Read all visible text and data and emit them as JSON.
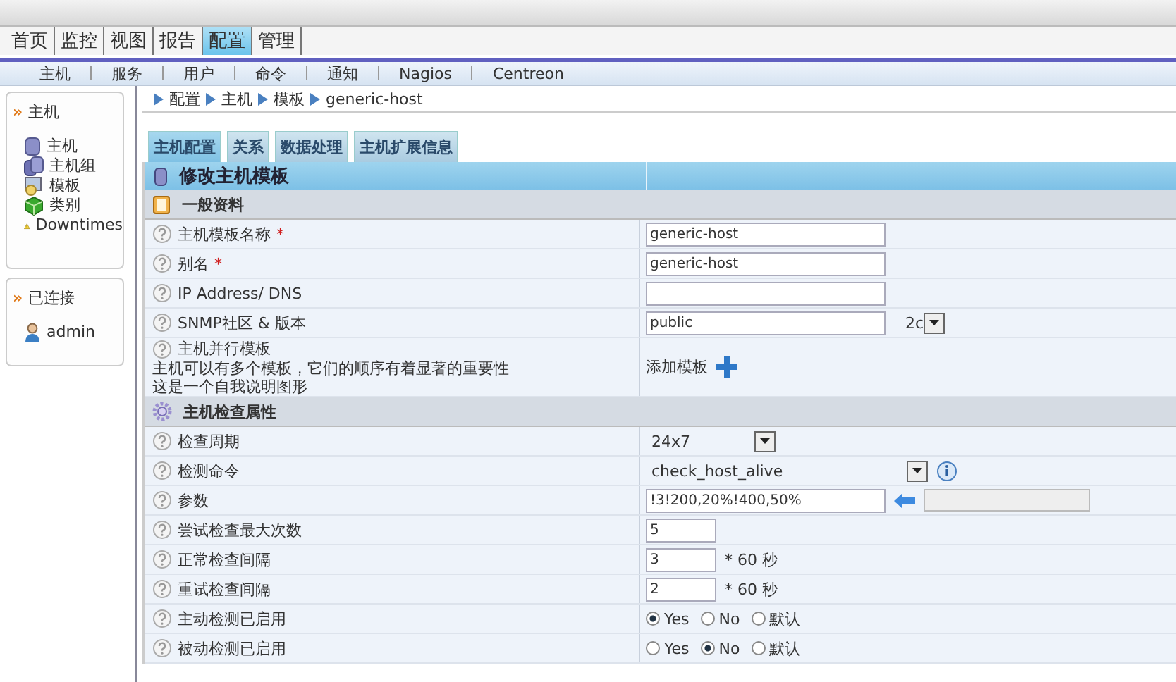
{
  "main_menu": [
    {
      "label": "首页",
      "selected": false
    },
    {
      "label": "监控",
      "selected": false
    },
    {
      "label": "视图",
      "selected": false
    },
    {
      "label": "报告",
      "selected": false
    },
    {
      "label": "配置",
      "selected": true
    },
    {
      "label": "管理",
      "selected": false
    }
  ],
  "sub_menu": [
    "主机",
    "服务",
    "用户",
    "命令",
    "通知",
    "Nagios",
    "Centreon"
  ],
  "sidebar": [
    {
      "bullet": "»",
      "title": "主机",
      "items": [
        {
          "label": "主机"
        },
        {
          "label": "主机组"
        },
        {
          "label": "模板"
        },
        {
          "label": "类别"
        },
        {
          "label": "Downtimes"
        }
      ]
    },
    {
      "bullet": "»",
      "title": "已连接",
      "items": [
        {
          "label": "admin"
        }
      ]
    }
  ],
  "breadcrumb": [
    "配置",
    "主机",
    "模板",
    "generic-host"
  ],
  "tabs": [
    {
      "label": "主机配置",
      "selected": true
    },
    {
      "label": "关系",
      "selected": false
    },
    {
      "label": "数据处理",
      "selected": false
    },
    {
      "label": "主机扩展信息",
      "selected": false
    }
  ],
  "form_title": "修改主机模板",
  "sections": [
    {
      "title": "一般资料",
      "rows": [
        {
          "kind": "text",
          "label": "主机模板名称",
          "mark": "*",
          "value": "generic-host"
        },
        {
          "kind": "text",
          "label": "别名",
          "mark": "*",
          "value": "generic-host"
        },
        {
          "kind": "text",
          "label": "IP Address/ DNS"
        },
        {
          "kind": "snmp",
          "label": "SNMP社区 & 版本",
          "value": "public",
          "version": "2c"
        },
        {
          "kind": "templates",
          "label": "主机并行模板",
          "notes": [
            "主机可以有多个模板，它们的顺序有着显著的重要性",
            "这是一个自我说明图形"
          ],
          "action": "添加模板"
        }
      ]
    },
    {
      "title": "主机检查属性",
      "rows": [
        {
          "kind": "select",
          "label": "检查周期",
          "value": "24x7"
        },
        {
          "kind": "command",
          "label": "检测命令",
          "value": "check_host_alive"
        },
        {
          "kind": "args",
          "label": "参数",
          "value": "!3!200,20%!400,50%"
        },
        {
          "kind": "number",
          "label": "尝试检查最大次数",
          "value": "5"
        },
        {
          "kind": "number",
          "label": "正常检查间隔",
          "value": "3",
          "unit": "* 60 秒"
        },
        {
          "kind": "number",
          "label": "重试检查间隔",
          "value": "2",
          "unit": "* 60 秒"
        },
        {
          "kind": "radio",
          "label": "主动检测已启用",
          "options": [
            {
              "label": "Yes",
              "selected": true
            },
            {
              "label": "No",
              "selected": false
            },
            {
              "label": "默认",
              "selected": false
            }
          ]
        },
        {
          "kind": "radio",
          "label": "被动检测已启用",
          "options": [
            {
              "label": "Yes",
              "selected": false
            },
            {
              "label": "No",
              "selected": true
            },
            {
              "label": "默认",
              "selected": false
            }
          ]
        }
      ]
    }
  ]
}
